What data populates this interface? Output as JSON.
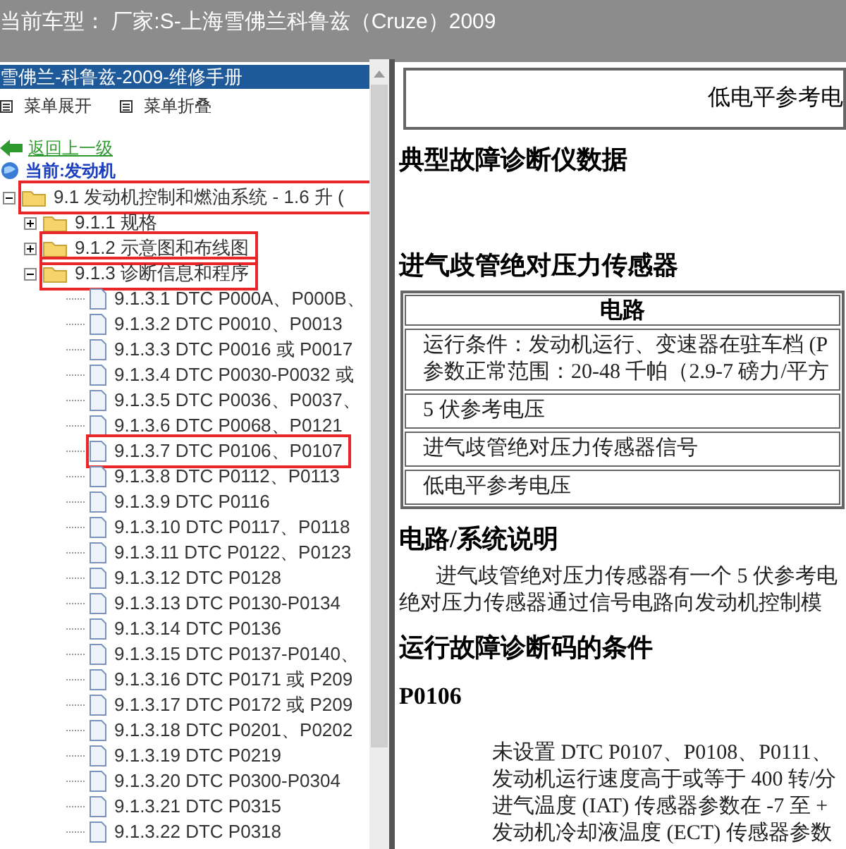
{
  "top_bar": {
    "title": "当前车型： 厂家:S-上海雪佛兰科鲁兹（Cruze）2009"
  },
  "left_panel": {
    "header": "雪佛兰-科鲁兹-2009-维修手册",
    "toolbar": [
      {
        "label": "菜单展开"
      },
      {
        "label": "菜单折叠"
      }
    ],
    "back_link": "返回上一级",
    "current": "当前:发动机",
    "tree": [
      {
        "kind": "folder",
        "label": "9.1 发动机控制和燃油系统 - 1.6 升 (",
        "expanded": true,
        "highlighted": true,
        "children": [
          {
            "kind": "folder",
            "label": "9.1.1 规格",
            "expanded": false,
            "highlighted": false
          },
          {
            "kind": "folder",
            "label": "9.1.2 示意图和布线图",
            "expanded": false,
            "highlighted": true
          },
          {
            "kind": "folder",
            "label": "9.1.3 诊断信息和程序",
            "expanded": true,
            "highlighted": true,
            "children": [
              {
                "kind": "doc",
                "label": "9.1.3.1 DTC P000A、P000B、",
                "highlighted": false
              },
              {
                "kind": "doc",
                "label": "9.1.3.2 DTC P0010、P0013",
                "highlighted": false
              },
              {
                "kind": "doc",
                "label": "9.1.3.3 DTC P0016 或 P0017",
                "highlighted": false
              },
              {
                "kind": "doc",
                "label": "9.1.3.4 DTC P0030-P0032 或",
                "highlighted": false
              },
              {
                "kind": "doc",
                "label": "9.1.3.5 DTC P0036、P0037、",
                "highlighted": false
              },
              {
                "kind": "doc",
                "label": "9.1.3.6 DTC P0068、P0121",
                "highlighted": false
              },
              {
                "kind": "doc",
                "label": "9.1.3.7 DTC P0106、P0107",
                "highlighted": true
              },
              {
                "kind": "doc",
                "label": "9.1.3.8 DTC P0112、P0113",
                "highlighted": false
              },
              {
                "kind": "doc",
                "label": "9.1.3.9 DTC P0116",
                "highlighted": false
              },
              {
                "kind": "doc",
                "label": "9.1.3.10 DTC P0117、P0118",
                "highlighted": false
              },
              {
                "kind": "doc",
                "label": "9.1.3.11 DTC P0122、P0123",
                "highlighted": false
              },
              {
                "kind": "doc",
                "label": "9.1.3.12 DTC P0128",
                "highlighted": false
              },
              {
                "kind": "doc",
                "label": "9.1.3.13 DTC P0130-P0134",
                "highlighted": false
              },
              {
                "kind": "doc",
                "label": "9.1.3.14 DTC P0136",
                "highlighted": false
              },
              {
                "kind": "doc",
                "label": "9.1.3.15 DTC P0137-P0140、",
                "highlighted": false
              },
              {
                "kind": "doc",
                "label": "9.1.3.16 DTC P0171 或 P209",
                "highlighted": false
              },
              {
                "kind": "doc",
                "label": "9.1.3.17 DTC P0172 或 P209",
                "highlighted": false
              },
              {
                "kind": "doc",
                "label": "9.1.3.18 DTC P0201、P0202",
                "highlighted": false
              },
              {
                "kind": "doc",
                "label": "9.1.3.19 DTC P0219",
                "highlighted": false
              },
              {
                "kind": "doc",
                "label": "9.1.3.20 DTC P0300-P0304",
                "highlighted": false
              },
              {
                "kind": "doc",
                "label": "9.1.3.21 DTC P0315",
                "highlighted": false
              },
              {
                "kind": "doc",
                "label": "9.1.3.22 DTC P0318",
                "highlighted": false
              }
            ]
          }
        ]
      }
    ]
  },
  "content": {
    "top_cell": "低电平参考电",
    "blocks": [
      {
        "kind": "heading",
        "text": "典型故障诊断仪数据"
      },
      {
        "kind": "heading",
        "text": "进气歧管绝对压力传感器"
      },
      {
        "kind": "table",
        "header": "电路",
        "rows": [
          [
            "运行条件：发动机运行、变速器在驻车档 (P",
            "参数正常范围：20-48 千帕（2.9-7 磅力/平方"
          ],
          [
            "5 伏参考电压"
          ],
          [
            "进气歧管绝对压力传感器信号"
          ],
          [
            "低电平参考电压"
          ]
        ]
      },
      {
        "kind": "heading",
        "text": "电路/系统说明"
      },
      {
        "kind": "paragraph",
        "lines": [
          "进气歧管绝对压力传感器有一个 5 伏参考电",
          "绝对压力传感器通过信号电路向发动机控制模"
        ]
      },
      {
        "kind": "heading",
        "text": "运行故障诊断码的条件"
      },
      {
        "kind": "subheading",
        "text": "P0106"
      },
      {
        "kind": "list",
        "lines": [
          "未设置 DTC P0107、P0108、P0111、",
          "发动机运行速度高于或等于 400 转/分",
          "进气温度 (IAT) 传感器参数在 -7 至 +",
          "发动机冷却液温度 (ECT) 传感器参数"
        ]
      }
    ]
  }
}
